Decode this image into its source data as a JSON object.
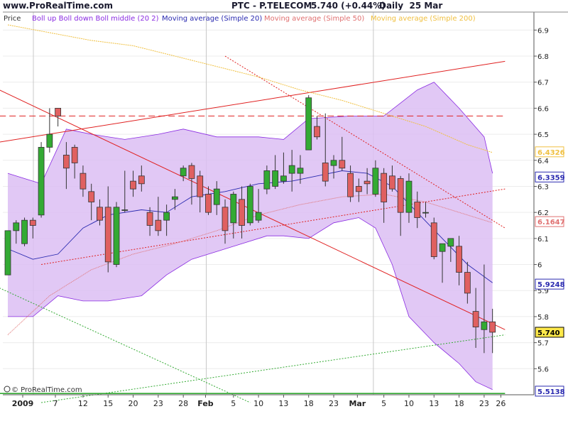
{
  "header": {
    "site": "www.ProRealTime.com",
    "instrument": "PTC - P.TELECOM",
    "quote": "5.740 (+0.44%)",
    "period": "Daily  25 Mar"
  },
  "legend": {
    "price": "Price",
    "boll": "Boll up Boll down Boll middle (20 2)",
    "ma20": "Moving average (Simple 20)",
    "ma50": "Moving average (Simple 50)",
    "ma200": "Moving average (Simple 200)"
  },
  "footer": {
    "copyright": "© ProRealTime.com"
  },
  "colors": {
    "bull": "#33aa33",
    "bear": "#e06060",
    "band": "#dcbef3",
    "band_edge": "#8a2be2",
    "ma20": "#2a2ab0",
    "ma50": "#e07070",
    "ma200": "#f0c040",
    "trend_red": "#e02020",
    "support": "#33aa33"
  },
  "chart_data": {
    "type": "candlestick",
    "y_axis": {
      "min": 5.5,
      "max": 6.92,
      "ticks": [
        5.6,
        5.7,
        5.8,
        5.9,
        6,
        6.1,
        6.2,
        6.3,
        6.4,
        6.5,
        6.6,
        6.7,
        6.8,
        6.9
      ]
    },
    "x_labels": [
      "2009",
      "7",
      "12",
      "15",
      "20",
      "23",
      "28",
      "Feb",
      "5",
      "10",
      "13",
      "18",
      "23",
      "Mar",
      "5",
      "10",
      "13",
      "18",
      "23",
      "26"
    ],
    "dates": [
      "2009-01-02",
      "2009-01-05",
      "2009-01-06",
      "2009-01-07",
      "2009-01-08",
      "2009-01-09",
      "2009-01-12",
      "2009-01-13",
      "2009-01-14",
      "2009-01-15",
      "2009-01-16",
      "2009-01-19",
      "2009-01-20",
      "2009-01-21",
      "2009-01-22",
      "2009-01-23",
      "2009-01-26",
      "2009-01-27",
      "2009-01-28",
      "2009-01-29",
      "2009-01-30",
      "2009-02-02",
      "2009-02-03",
      "2009-02-04",
      "2009-02-05",
      "2009-02-06",
      "2009-02-09",
      "2009-02-10",
      "2009-02-11",
      "2009-02-12",
      "2009-02-13",
      "2009-02-16",
      "2009-02-17",
      "2009-02-18",
      "2009-02-19",
      "2009-02-20",
      "2009-02-23",
      "2009-02-24",
      "2009-02-25",
      "2009-02-26",
      "2009-02-27",
      "2009-03-02",
      "2009-03-03",
      "2009-03-04",
      "2009-03-05",
      "2009-03-06",
      "2009-03-09",
      "2009-03-10",
      "2009-03-11",
      "2009-03-12",
      "2009-03-13",
      "2009-03-16",
      "2009-03-17",
      "2009-03-18",
      "2009-03-19",
      "2009-03-20",
      "2009-03-23",
      "2009-03-24",
      "2009-03-25"
    ],
    "candles": [
      {
        "o": 5.96,
        "h": 6.13,
        "l": 5.96,
        "c": 6.13
      },
      {
        "o": 6.13,
        "h": 6.17,
        "l": 6.08,
        "c": 6.16
      },
      {
        "o": 6.08,
        "h": 6.18,
        "l": 6.07,
        "c": 6.17
      },
      {
        "o": 6.17,
        "h": 6.18,
        "l": 6.1,
        "c": 6.15
      },
      {
        "o": 6.19,
        "h": 6.47,
        "l": 6.18,
        "c": 6.45
      },
      {
        "o": 6.45,
        "h": 6.6,
        "l": 6.43,
        "c": 6.5
      },
      {
        "o": 6.6,
        "h": 6.6,
        "l": 6.53,
        "c": 6.57
      },
      {
        "o": 6.42,
        "h": 6.47,
        "l": 6.29,
        "c": 6.37
      },
      {
        "o": 6.45,
        "h": 6.46,
        "l": 6.33,
        "c": 6.39
      },
      {
        "o": 6.35,
        "h": 6.38,
        "l": 6.26,
        "c": 6.29
      },
      {
        "o": 6.28,
        "h": 6.31,
        "l": 6.17,
        "c": 6.24
      },
      {
        "o": 6.22,
        "h": 6.25,
        "l": 6.15,
        "c": 6.17
      },
      {
        "o": 6.22,
        "h": 6.3,
        "l": 5.97,
        "c": 6.01
      },
      {
        "o": 6.0,
        "h": 6.24,
        "l": 5.99,
        "c": 6.22
      },
      {
        "o": 6.21,
        "h": 6.36,
        "l": 6.2,
        "c": 6.21
      },
      {
        "o": 6.32,
        "h": 6.36,
        "l": 6.26,
        "c": 6.29
      },
      {
        "o": 6.34,
        "h": 6.38,
        "l": 6.28,
        "c": 6.31
      },
      {
        "o": 6.2,
        "h": 6.22,
        "l": 6.11,
        "c": 6.15
      },
      {
        "o": 6.17,
        "h": 6.26,
        "l": 6.11,
        "c": 6.13
      },
      {
        "o": 6.17,
        "h": 6.23,
        "l": 6.11,
        "c": 6.2
      },
      {
        "o": 6.25,
        "h": 6.29,
        "l": 6.21,
        "c": 6.26
      },
      {
        "o": 6.34,
        "h": 6.38,
        "l": 6.32,
        "c": 6.37
      },
      {
        "o": 6.38,
        "h": 6.39,
        "l": 6.23,
        "c": 6.33
      },
      {
        "o": 6.34,
        "h": 6.36,
        "l": 6.2,
        "c": 6.26
      },
      {
        "o": 6.27,
        "h": 6.3,
        "l": 6.19,
        "c": 6.2
      },
      {
        "o": 6.23,
        "h": 6.32,
        "l": 6.19,
        "c": 6.29
      },
      {
        "o": 6.22,
        "h": 6.25,
        "l": 6.08,
        "c": 6.13
      },
      {
        "o": 6.16,
        "h": 6.28,
        "l": 6.1,
        "c": 6.27
      },
      {
        "o": 6.25,
        "h": 6.3,
        "l": 6.1,
        "c": 6.15
      },
      {
        "o": 6.16,
        "h": 6.31,
        "l": 6.15,
        "c": 6.3
      },
      {
        "o": 6.17,
        "h": 6.29,
        "l": 6.16,
        "c": 6.2
      },
      {
        "o": 6.29,
        "h": 6.38,
        "l": 6.27,
        "c": 6.36
      },
      {
        "o": 6.3,
        "h": 6.42,
        "l": 6.29,
        "c": 6.36
      },
      {
        "o": 6.32,
        "h": 6.43,
        "l": 6.31,
        "c": 6.34
      },
      {
        "o": 6.35,
        "h": 6.44,
        "l": 6.28,
        "c": 6.38
      },
      {
        "o": 6.35,
        "h": 6.42,
        "l": 6.31,
        "c": 6.37
      },
      {
        "o": 6.44,
        "h": 6.65,
        "l": 6.44,
        "c": 6.64
      },
      {
        "o": 6.53,
        "h": 6.57,
        "l": 6.48,
        "c": 6.49
      },
      {
        "o": 6.39,
        "h": 6.58,
        "l": 6.3,
        "c": 6.32
      },
      {
        "o": 6.38,
        "h": 6.42,
        "l": 6.33,
        "c": 6.4
      },
      {
        "o": 6.4,
        "h": 6.49,
        "l": 6.36,
        "c": 6.37
      },
      {
        "o": 6.35,
        "h": 6.38,
        "l": 6.24,
        "c": 6.26
      },
      {
        "o": 6.3,
        "h": 6.33,
        "l": 6.24,
        "c": 6.28
      },
      {
        "o": 6.32,
        "h": 6.37,
        "l": 6.27,
        "c": 6.31
      },
      {
        "o": 6.27,
        "h": 6.4,
        "l": 6.26,
        "c": 6.37
      },
      {
        "o": 6.35,
        "h": 6.37,
        "l": 6.16,
        "c": 6.24
      },
      {
        "o": 6.34,
        "h": 6.38,
        "l": 6.28,
        "c": 6.29
      },
      {
        "o": 6.33,
        "h": 6.34,
        "l": 6.11,
        "c": 6.2
      },
      {
        "o": 6.2,
        "h": 6.35,
        "l": 6.16,
        "c": 6.32
      },
      {
        "o": 6.24,
        "h": 6.28,
        "l": 6.14,
        "c": 6.18
      },
      {
        "o": 6.2,
        "h": 6.24,
        "l": 6.18,
        "c": 6.2
      },
      {
        "o": 6.16,
        "h": 6.18,
        "l": 6.02,
        "c": 6.03
      },
      {
        "o": 6.05,
        "h": 6.07,
        "l": 5.93,
        "c": 6.08
      },
      {
        "o": 6.07,
        "h": 6.1,
        "l": 6.01,
        "c": 6.1
      },
      {
        "o": 6.07,
        "h": 6.11,
        "l": 5.92,
        "c": 5.97
      },
      {
        "o": 5.97,
        "h": 6.01,
        "l": 5.85,
        "c": 5.89
      },
      {
        "o": 5.82,
        "h": 5.91,
        "l": 5.68,
        "c": 5.76
      },
      {
        "o": 5.75,
        "h": 6.0,
        "l": 5.66,
        "c": 5.78
      },
      {
        "o": 5.78,
        "h": 5.83,
        "l": 5.66,
        "c": 5.74
      }
    ],
    "indicators": {
      "boll_upper": [
        {
          "x": 0,
          "y": 6.35
        },
        {
          "x": 4,
          "y": 6.31
        },
        {
          "x": 7,
          "y": 6.52
        },
        {
          "x": 10,
          "y": 6.5
        },
        {
          "x": 14,
          "y": 6.48
        },
        {
          "x": 18,
          "y": 6.5
        },
        {
          "x": 21,
          "y": 6.52
        },
        {
          "x": 25,
          "y": 6.49
        },
        {
          "x": 30,
          "y": 6.49
        },
        {
          "x": 33,
          "y": 6.48
        },
        {
          "x": 36,
          "y": 6.56
        },
        {
          "x": 41,
          "y": 6.57
        },
        {
          "x": 45,
          "y": 6.57
        },
        {
          "x": 47,
          "y": 6.62
        },
        {
          "x": 49,
          "y": 6.67
        },
        {
          "x": 51,
          "y": 6.7
        },
        {
          "x": 54,
          "y": 6.6
        },
        {
          "x": 57,
          "y": 6.49
        },
        {
          "x": 58,
          "y": 6.35
        }
      ],
      "boll_lower": [
        {
          "x": 0,
          "y": 5.8
        },
        {
          "x": 3,
          "y": 5.8
        },
        {
          "x": 6,
          "y": 5.88
        },
        {
          "x": 9,
          "y": 5.86
        },
        {
          "x": 12,
          "y": 5.86
        },
        {
          "x": 16,
          "y": 5.88
        },
        {
          "x": 19,
          "y": 5.96
        },
        {
          "x": 22,
          "y": 6.02
        },
        {
          "x": 25,
          "y": 6.05
        },
        {
          "x": 28,
          "y": 6.08
        },
        {
          "x": 31,
          "y": 6.11
        },
        {
          "x": 33,
          "y": 6.11
        },
        {
          "x": 36,
          "y": 6.1
        },
        {
          "x": 39,
          "y": 6.16
        },
        {
          "x": 42,
          "y": 6.18
        },
        {
          "x": 44,
          "y": 6.14
        },
        {
          "x": 46,
          "y": 6.0
        },
        {
          "x": 48,
          "y": 5.8
        },
        {
          "x": 51,
          "y": 5.7
        },
        {
          "x": 54,
          "y": 5.62
        },
        {
          "x": 56,
          "y": 5.55
        },
        {
          "x": 58,
          "y": 5.52
        }
      ],
      "ma20": [
        {
          "x": 0,
          "y": 6.06
        },
        {
          "x": 3,
          "y": 6.02
        },
        {
          "x": 6,
          "y": 6.04
        },
        {
          "x": 9,
          "y": 6.14
        },
        {
          "x": 12,
          "y": 6.19
        },
        {
          "x": 16,
          "y": 6.21
        },
        {
          "x": 19,
          "y": 6.2
        },
        {
          "x": 22,
          "y": 6.26
        },
        {
          "x": 26,
          "y": 6.28
        },
        {
          "x": 30,
          "y": 6.31
        },
        {
          "x": 34,
          "y": 6.32
        },
        {
          "x": 37,
          "y": 6.34
        },
        {
          "x": 40,
          "y": 6.36
        },
        {
          "x": 43,
          "y": 6.35
        },
        {
          "x": 46,
          "y": 6.3
        },
        {
          "x": 49,
          "y": 6.2
        },
        {
          "x": 52,
          "y": 6.1
        },
        {
          "x": 55,
          "y": 6.0
        },
        {
          "x": 58,
          "y": 5.93
        }
      ],
      "ma50": [
        {
          "x": 0,
          "y": 5.73
        },
        {
          "x": 5,
          "y": 5.88
        },
        {
          "x": 10,
          "y": 5.98
        },
        {
          "x": 15,
          "y": 6.04
        },
        {
          "x": 20,
          "y": 6.08
        },
        {
          "x": 25,
          "y": 6.13
        },
        {
          "x": 30,
          "y": 6.19
        },
        {
          "x": 35,
          "y": 6.23
        },
        {
          "x": 40,
          "y": 6.26
        },
        {
          "x": 45,
          "y": 6.27
        },
        {
          "x": 50,
          "y": 6.24
        },
        {
          "x": 55,
          "y": 6.19
        },
        {
          "x": 58,
          "y": 6.16
        }
      ],
      "ma200": [
        {
          "x": 0,
          "y": 6.92
        },
        {
          "x": 5,
          "y": 6.89
        },
        {
          "x": 10,
          "y": 6.86
        },
        {
          "x": 15,
          "y": 6.84
        },
        {
          "x": 20,
          "y": 6.8
        },
        {
          "x": 25,
          "y": 6.76
        },
        {
          "x": 30,
          "y": 6.72
        },
        {
          "x": 35,
          "y": 6.67
        },
        {
          "x": 40,
          "y": 6.63
        },
        {
          "x": 45,
          "y": 6.58
        },
        {
          "x": 50,
          "y": 6.53
        },
        {
          "x": 55,
          "y": 6.46
        },
        {
          "x": 58,
          "y": 6.43
        }
      ]
    },
    "trendlines": [
      {
        "from": {
          "x": -1,
          "y": 6.67
        },
        "to": {
          "x": 59.5,
          "y": 5.75
        },
        "style": "solid",
        "color": "#e02020"
      },
      {
        "from": {
          "x": -1,
          "y": 6.47
        },
        "to": {
          "x": 59.5,
          "y": 6.78
        },
        "style": "solid",
        "color": "#e02020"
      },
      {
        "from": {
          "x": -1,
          "y": 6.57
        },
        "to": {
          "x": 59.5,
          "y": 6.57
        },
        "style": "dashed",
        "color": "#e02020"
      },
      {
        "from": {
          "x": 26,
          "y": 6.8
        },
        "to": {
          "x": 59.5,
          "y": 6.14
        },
        "style": "dotted",
        "color": "#e02020"
      },
      {
        "from": {
          "x": 4,
          "y": 6.0
        },
        "to": {
          "x": 59.5,
          "y": 6.29
        },
        "style": "dotted",
        "color": "#e02020"
      },
      {
        "from": {
          "x": -1,
          "y": 5.91
        },
        "to": {
          "x": 29,
          "y": 5.47
        },
        "style": "dotted",
        "color": "#33aa33"
      },
      {
        "from": {
          "x": 4,
          "y": 5.47
        },
        "to": {
          "x": 59.5,
          "y": 5.73
        },
        "style": "dotted",
        "color": "#33aa33"
      },
      {
        "from": {
          "x": -1,
          "y": 5.505
        },
        "to": {
          "x": 59.5,
          "y": 5.505
        },
        "style": "solid",
        "color": "#33aa33"
      }
    ],
    "price_labels": [
      {
        "value": "6.4326",
        "y": 6.4326,
        "color": "#f0c040"
      },
      {
        "value": "6.3359",
        "y": 6.3359,
        "color": "#2a2ab0"
      },
      {
        "value": "6.1647",
        "y": 6.1647,
        "color": "#e07070"
      },
      {
        "value": "5.9248",
        "y": 5.9248,
        "color": "#2a2ab0"
      },
      {
        "value": "5.740",
        "y": 5.74,
        "color": "#000000"
      },
      {
        "value": "5.5138",
        "y": 5.5138,
        "color": "#2a2ab0"
      }
    ]
  }
}
